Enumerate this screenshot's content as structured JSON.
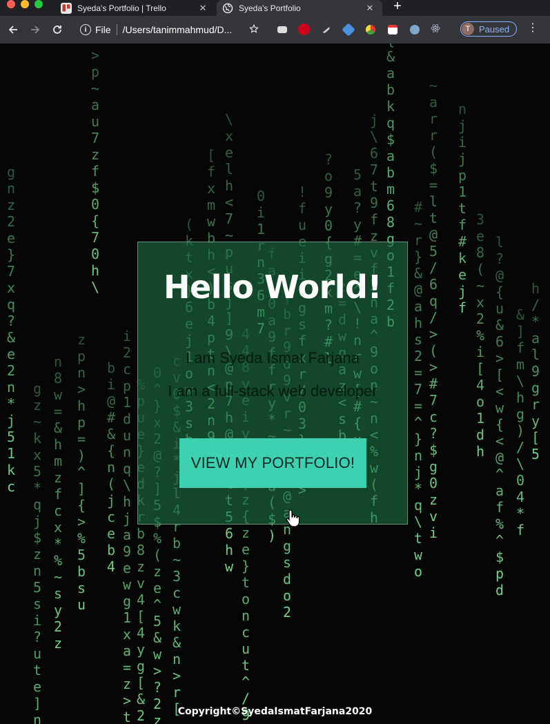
{
  "browser": {
    "tabs": [
      {
        "title": "Syeda's Portfolio | Trello",
        "favicon": "trello-icon",
        "active": false
      },
      {
        "title": "Syeda's Portfolio",
        "favicon": "globe-icon",
        "active": true
      }
    ],
    "address": {
      "scheme_label": "File",
      "path": "/Users/tanimmahmud/D..."
    },
    "extensions": [
      "bookmark-star-icon",
      "window-icon",
      "adblock-plus-icon",
      "pencil-icon",
      "shield-icon",
      "chrome-ext-icon",
      "calendar-icon",
      "puzzle-icon",
      "react-icon"
    ],
    "profile": {
      "initial": "T",
      "status": "Paused"
    }
  },
  "page": {
    "card": {
      "title": "Hello World!",
      "line1": "I am Syeda Ismat Farjana",
      "line2": "I am a full-stack web developer",
      "button_label": "VIEW MY PORTFOLIO!"
    },
    "footer": "Copyright©SyedaIsmatFarjana2020"
  },
  "colors": {
    "matrix_green": "#7ee29a",
    "card_bg": "#1b6e46",
    "button_bg": "#3ed1b0",
    "page_bg": "#060606"
  }
}
